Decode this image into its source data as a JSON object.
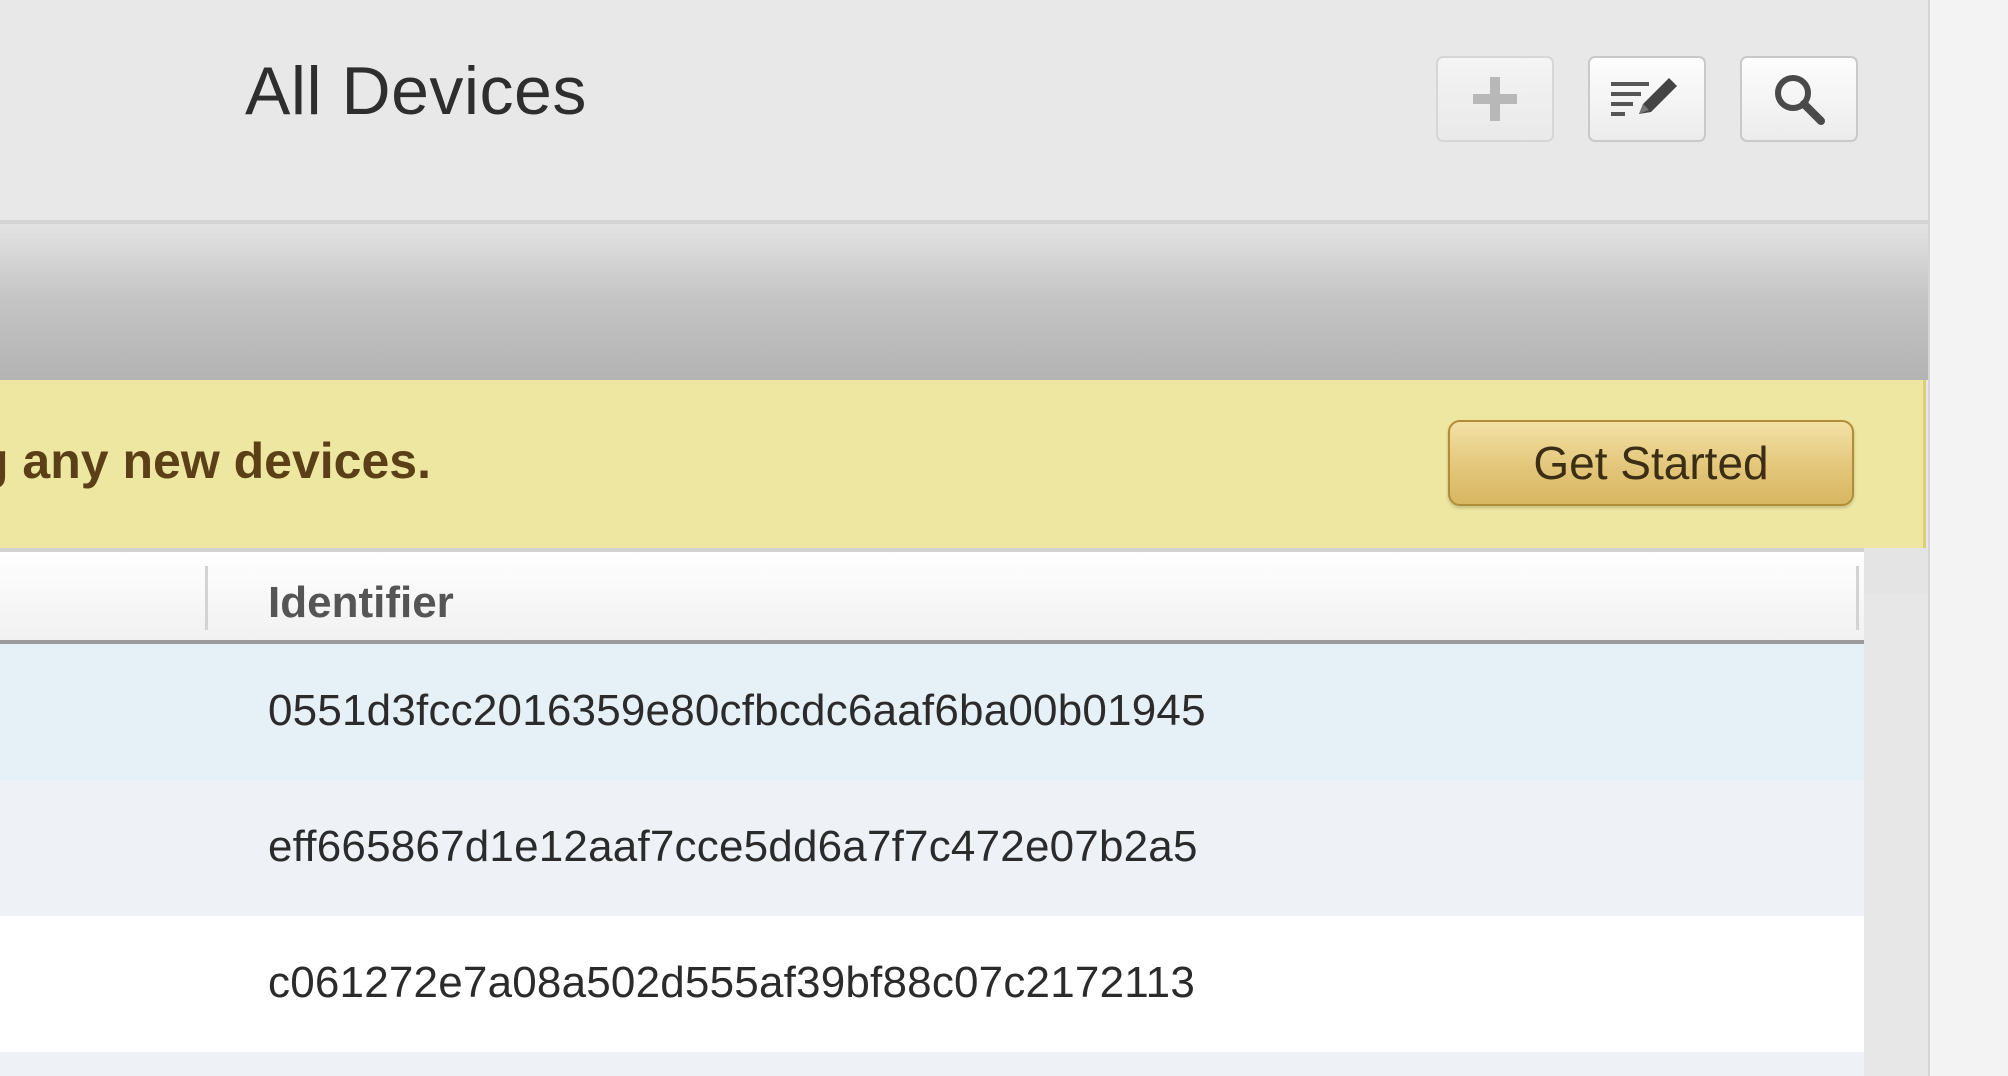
{
  "header": {
    "title": "All Devices",
    "toolbar": {
      "add_icon": "plus-icon",
      "edit_icon": "edit-list-icon",
      "search_icon": "search-icon"
    }
  },
  "banner": {
    "text": "g any new devices.",
    "button_label": "Get Started"
  },
  "table": {
    "columns": [
      "Identifier"
    ],
    "rows": [
      {
        "identifier": "0551d3fcc2016359e80cfbcdc6aaf6ba00b01945"
      },
      {
        "identifier": "eff665867d1e12aaf7cce5dd6a7f7c472e07b2a5"
      },
      {
        "identifier": "c061272e7a08a502d555af39bf88c07c2172113"
      }
    ]
  },
  "colors": {
    "banner_bg": "#ede7a2",
    "banner_text": "#5b3f17",
    "button_gold": "#e3c67a",
    "row_highlight": "#e6f0f7"
  }
}
